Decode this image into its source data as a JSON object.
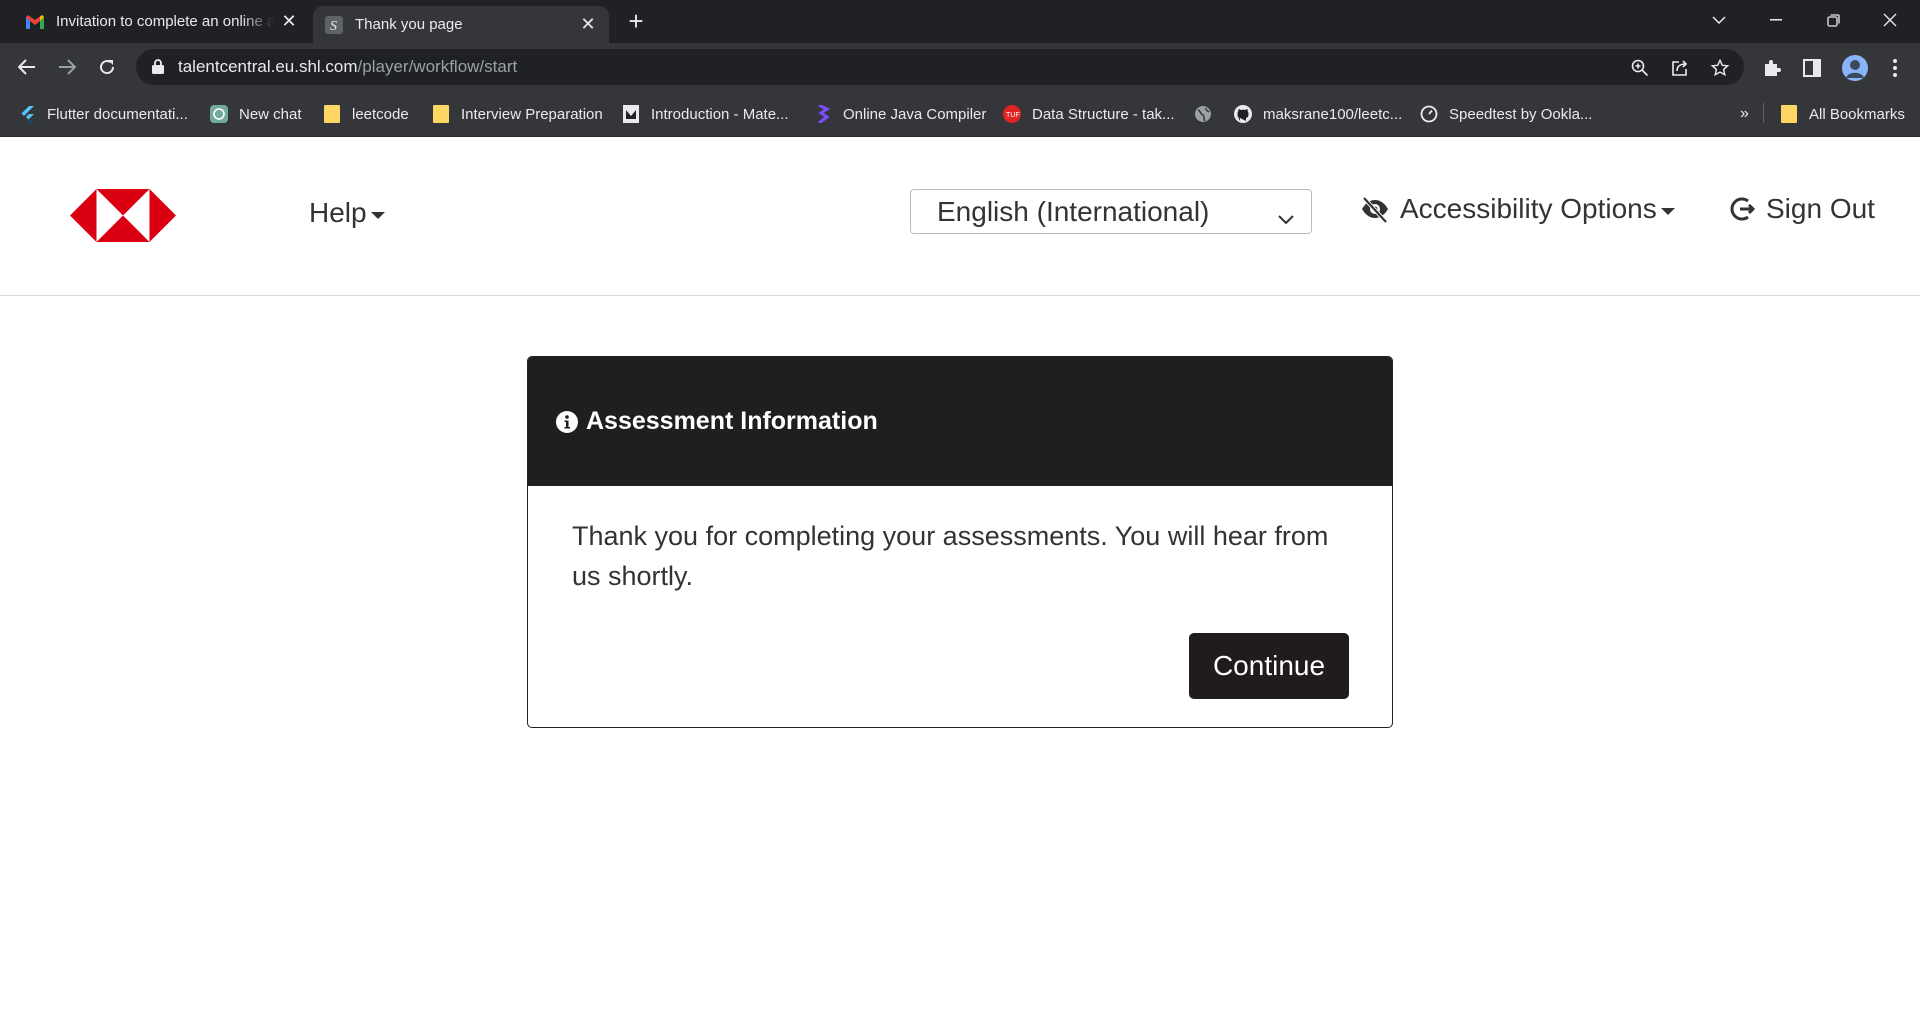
{
  "browser": {
    "tabs": [
      {
        "title": "Invitation to complete an online assessment",
        "icon": "gmail-icon"
      },
      {
        "title": "Thank you page",
        "icon": "shl-icon",
        "active": true
      }
    ],
    "url_host": "talentcentral.eu.shl.com",
    "url_path": "/player/workflow/start",
    "bookmarks": [
      {
        "label": "Flutter documentati...",
        "icon": "flutter-icon"
      },
      {
        "label": "New chat",
        "icon": "chatgpt-icon"
      },
      {
        "label": "leetcode",
        "icon": "folder-icon"
      },
      {
        "label": "Interview Preparation",
        "icon": "folder-icon"
      },
      {
        "label": "Introduction - Mate...",
        "icon": "page-icon"
      },
      {
        "label": "Online Java Compiler",
        "icon": "compiler-icon"
      },
      {
        "label": "Data Structure - tak...",
        "icon": "tuf-icon"
      },
      {
        "label": "",
        "icon": "globe-icon"
      },
      {
        "label": "maksrane100/leetc...",
        "icon": "github-icon"
      },
      {
        "label": "Speedtest by Ookla...",
        "icon": "speedtest-icon"
      }
    ],
    "overflow_label": "»",
    "all_bookmarks": "All Bookmarks"
  },
  "header": {
    "help_label": "Help",
    "language_selected": "English (International)",
    "accessibility_label": "Accessibility Options",
    "signout_label": "Sign Out"
  },
  "card": {
    "title": "Assessment Information",
    "message": "Thank you for completing your assessments. You will hear from us shortly.",
    "continue_label": "Continue"
  },
  "colors": {
    "brand_red": "#db0011",
    "card_header_bg": "#211e22",
    "button_bg": "#1f1b1f"
  }
}
